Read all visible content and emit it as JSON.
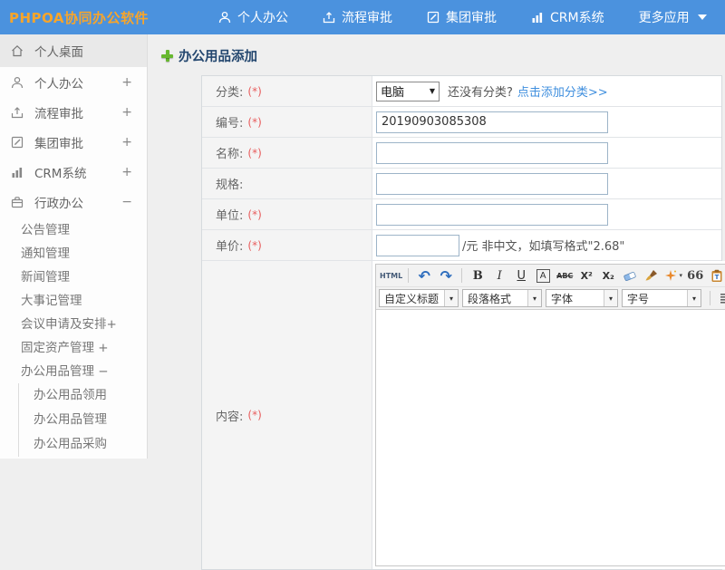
{
  "colors": {
    "header_blue": "#4b92de",
    "logo_orange": "#f7a52b",
    "link_blue": "#3e8ede",
    "required_red": "#e85d5d",
    "title_navy": "#24476f",
    "plus_green": "#67b82f"
  },
  "icons": {
    "caret_down": "▼",
    "caret_small": "▾"
  },
  "header": {
    "logo": "PHPOA协同办公软件",
    "nav": [
      {
        "label": "个人办公",
        "icon": "person-icon"
      },
      {
        "label": "流程审批",
        "icon": "approval-icon"
      },
      {
        "label": "集团审批",
        "icon": "edit-icon"
      },
      {
        "label": "CRM系统",
        "icon": "chart-icon"
      },
      {
        "label": "更多应用",
        "icon": "caret-down-icon"
      }
    ]
  },
  "sidebar": {
    "items": [
      {
        "label": "个人桌面",
        "expand": "",
        "icon": "home-icon"
      },
      {
        "label": "个人办公",
        "expand": "+",
        "icon": "person-icon"
      },
      {
        "label": "流程审批",
        "expand": "+",
        "icon": "approval-icon"
      },
      {
        "label": "集团审批",
        "expand": "+",
        "icon": "edit-icon"
      },
      {
        "label": "CRM系统",
        "expand": "+",
        "icon": "chart-icon"
      },
      {
        "label": "行政办公",
        "expand": "−",
        "icon": "briefcase-icon"
      }
    ],
    "admin_subitems": [
      {
        "label": "公告管理"
      },
      {
        "label": "通知管理"
      },
      {
        "label": "新闻管理"
      },
      {
        "label": "大事记管理"
      },
      {
        "label": "会议申请及安排+"
      },
      {
        "label": "固定资产管理 +"
      },
      {
        "label": "办公用品管理 −"
      }
    ],
    "supplies_subitems": [
      {
        "label": "办公用品领用"
      },
      {
        "label": "办公用品管理"
      },
      {
        "label": "办公用品采购"
      }
    ]
  },
  "page": {
    "title": "办公用品添加"
  },
  "form": {
    "category": {
      "label": "分类:",
      "required": "(*)",
      "selected": "电脑",
      "question": "还没有分类?",
      "add_link": "点击添加分类>>"
    },
    "code": {
      "label": "编号:",
      "required": "(*)",
      "value": "20190903085308"
    },
    "name": {
      "label": "名称:",
      "required": "(*)",
      "value": ""
    },
    "spec": {
      "label": "规格:",
      "required": "",
      "value": ""
    },
    "unit": {
      "label": "单位:",
      "required": "(*)",
      "value": ""
    },
    "price": {
      "label": "单价:",
      "required": "(*)",
      "value": "",
      "hint": "/元 非中文，如填写格式\"2.68\""
    },
    "content": {
      "label": "内容:",
      "required": "(*)"
    }
  },
  "editor": {
    "source_label": "HTML",
    "glyphs": {
      "undo": "↶",
      "redo": "↷",
      "bold": "B",
      "italic": "I",
      "underline": "U",
      "fontbox": "A",
      "strike": "ABC",
      "sup": "X²",
      "sub": "X₂",
      "quote": "66",
      "fontcolor": "A",
      "highlight": "ab"
    },
    "dropdowns": [
      {
        "label": "自定义标题"
      },
      {
        "label": "段落格式"
      },
      {
        "label": "字体"
      },
      {
        "label": "字号"
      }
    ]
  }
}
